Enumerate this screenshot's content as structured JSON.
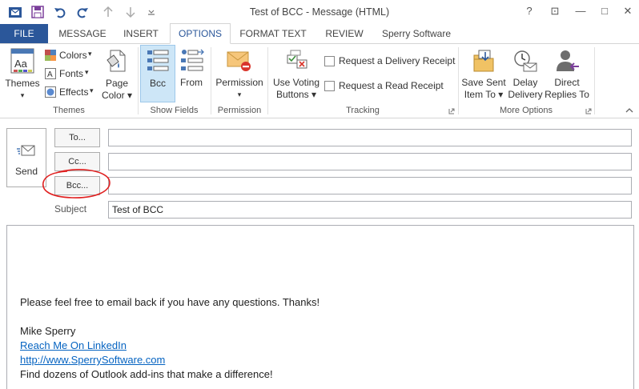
{
  "window": {
    "title": "Test of BCC - Message (HTML)",
    "help": "?",
    "ribbon_display": "⊡",
    "minimize": "—",
    "restore": "□",
    "close": "✕"
  },
  "tabs": [
    "FILE",
    "MESSAGE",
    "INSERT",
    "OPTIONS",
    "FORMAT TEXT",
    "REVIEW",
    "Sperry Software"
  ],
  "ribbon": {
    "themes": {
      "themes_label": "Themes",
      "colors_label": "Colors",
      "fonts_label": "Fonts",
      "effects_label": "Effects",
      "page_color_label_1": "Page",
      "page_color_label_2": "Color",
      "group_label": "Themes"
    },
    "show_fields": {
      "bcc_label": "Bcc",
      "from_label": "From",
      "group_label": "Show Fields"
    },
    "permission": {
      "permission_label": "Permission",
      "group_label": "Permission"
    },
    "tracking": {
      "voting_label_1": "Use Voting",
      "voting_label_2": "Buttons",
      "delivery_receipt_label": "Request a Delivery Receipt",
      "read_receipt_label": "Request a Read Receipt",
      "group_label": "Tracking"
    },
    "more_options": {
      "save_sent_label_1": "Save Sent",
      "save_sent_label_2": "Item To",
      "delay_label_1": "Delay",
      "delay_label_2": "Delivery",
      "direct_label_1": "Direct",
      "direct_label_2": "Replies To",
      "group_label": "More Options"
    }
  },
  "compose": {
    "send_label": "Send",
    "to_button": "To...",
    "cc_button": "Cc...",
    "bcc_button": "Bcc...",
    "subject_label": "Subject",
    "to_value": "",
    "cc_value": "",
    "bcc_value": "",
    "subject_value": "Test of BCC"
  },
  "body": {
    "line1": "Please feel free to email back if you have any questions.  Thanks!",
    "signature_name": "Mike Sperry",
    "link1": "Reach Me On LinkedIn",
    "link2": "http://www.SperrySoftware.com",
    "tagline": "Find dozens of Outlook add-ins that make a difference!"
  },
  "colors": {
    "accent": "#2b579a",
    "highlight": "#cde6f7",
    "annotation": "#e02020",
    "link": "#0563c1"
  }
}
